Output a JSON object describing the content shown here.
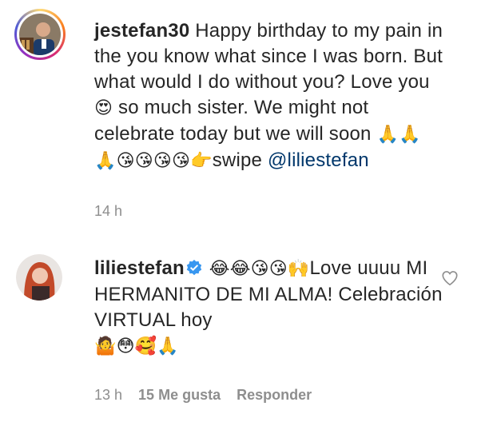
{
  "comment1": {
    "username": "jestefan30",
    "text_a": " Happy birthday to my pain in the you know what since I was born. But what would I do without you? Love you ",
    "emoji_a": "😍",
    "text_b": " so much sister. We might not celebrate today but we will soon ",
    "emoji_b": "🙏🙏",
    "emoji_c": "🙏😘😘😘😘👉",
    "text_c": "swipe ",
    "mention": "@liliestefan",
    "time": "14 h"
  },
  "comment2": {
    "username": "liliestefan",
    "emoji_a": "😂😂😘😘🙌",
    "text_a": "Love uuuu MI HERMANITO DE MI ALMA! Celebración VIRTUAL hoy",
    "emoji_b": "🤷😳🥰🙏",
    "time": "13 h",
    "likes": "15 Me gusta",
    "reply": "Responder"
  },
  "icons": {
    "verified": "verified-badge-icon",
    "like": "heart-outline-icon"
  },
  "colors": {
    "text": "#262626",
    "muted": "#8e8e8e",
    "mention": "#00376b",
    "verified": "#3897f0"
  }
}
